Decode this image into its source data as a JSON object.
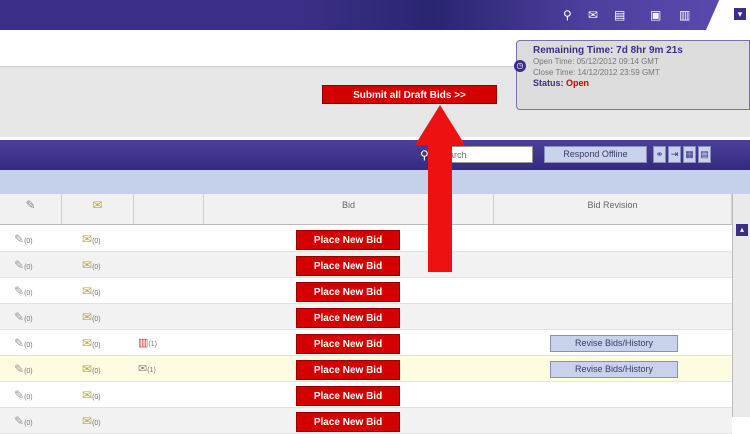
{
  "topbar": {
    "icons": [
      "pin-icon",
      "mail-icon",
      "print-icon",
      "save-icon",
      "document-icon"
    ],
    "collapse_label": "▾"
  },
  "timer": {
    "remaining": "Remaining Time: 7d 8hr 9m 21s",
    "open_time": "Open Time: 05/12/2012 09:14 GMT",
    "close_time": "Close Time: 14/12/2012 23:59 GMT",
    "status_label": "Status:",
    "status_value": "Open"
  },
  "actions": {
    "submit_all": "Submit all Draft Bids >>"
  },
  "toolbar": {
    "search_placeholder": "Search",
    "respond_offline": "Respond Offline"
  },
  "table": {
    "headers": [
      "",
      "",
      "",
      "Bid",
      "Bid Revision"
    ],
    "rows": [
      {
        "pencil_count": "(0)",
        "env_count": "(0)",
        "msg": "",
        "msg_count": "",
        "bid": "Place New Bid",
        "revise": ""
      },
      {
        "pencil_count": "(0)",
        "env_count": "(0)",
        "msg": "",
        "msg_count": "",
        "bid": "Place New Bid",
        "revise": ""
      },
      {
        "pencil_count": "(0)",
        "env_count": "(0)",
        "msg": "",
        "msg_count": "",
        "bid": "Place New Bid",
        "revise": ""
      },
      {
        "pencil_count": "(0)",
        "env_count": "(0)",
        "msg": "",
        "msg_count": "",
        "bid": "Place New Bid",
        "revise": ""
      },
      {
        "pencil_count": "(0)",
        "env_count": "(0)",
        "msg": "doc",
        "msg_count": "(1)",
        "bid": "Place New Bid",
        "revise": "Revise Bids/History"
      },
      {
        "pencil_count": "(0)",
        "env_count": "(0)",
        "msg": "env",
        "msg_count": "(1)",
        "bid": "Place New Bid",
        "revise": "Revise Bids/History"
      },
      {
        "pencil_count": "(0)",
        "env_count": "(0)",
        "msg": "",
        "msg_count": "",
        "bid": "Place New Bid",
        "revise": ""
      },
      {
        "pencil_count": "(0)",
        "env_count": "(0)",
        "msg": "",
        "msg_count": "",
        "bid": "Place New Bid",
        "revise": ""
      }
    ]
  },
  "colors": {
    "brand_purple": "#3a2f86",
    "action_red": "#d40000",
    "annotation_arrow": "#ee1111"
  }
}
